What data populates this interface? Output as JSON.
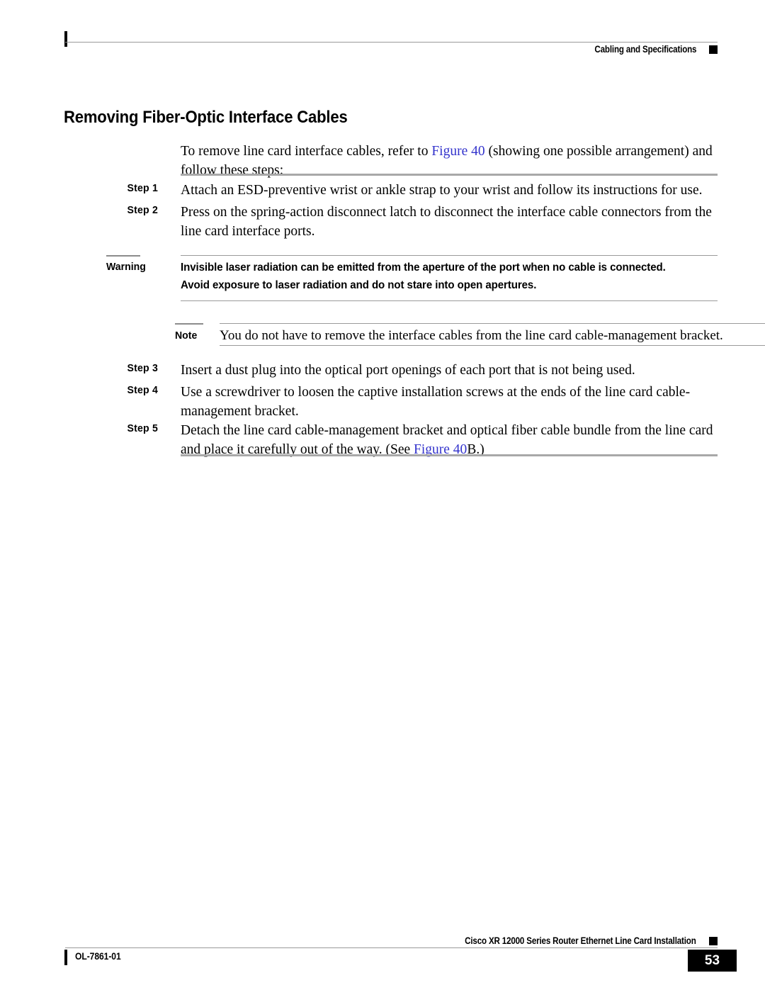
{
  "header": {
    "title": "Cabling and Specifications",
    "marker_icon": "black-square-marker"
  },
  "section": {
    "heading": "Removing Fiber-Optic Interface Cables",
    "intro_before_link": "To remove line card interface cables, refer to ",
    "intro_link": "Figure 40",
    "intro_after_link": " (showing one possible arrangement) and follow these steps:"
  },
  "steps": [
    {
      "label": "Step 1",
      "text": "Attach an ESD-preventive wrist or ankle strap to your wrist and follow its instructions for use."
    },
    {
      "label": "Step 2",
      "text": "Press on the spring-action disconnect latch to disconnect the interface cable connectors from the line card interface ports."
    },
    {
      "label": "Step 3",
      "text": "Insert a dust plug into the optical port openings of each port that is not being used."
    },
    {
      "label": "Step 4",
      "text": "Use a screwdriver to loosen the captive installation screws at the ends of the line card cable-management bracket."
    },
    {
      "label": "Step 5",
      "text_before_link": "Detach the line card cable-management bracket and optical fiber cable bundle from the line card and place it carefully out of the way. (See ",
      "link": "Figure 40",
      "text_after_link": "B.)"
    }
  ],
  "warning": {
    "label": "Warning",
    "text": "Invisible laser radiation can be emitted from the aperture of the port when no cable is connected. Avoid exposure to laser radiation and do not stare into open apertures."
  },
  "note": {
    "label": "Note",
    "text": "You do not have to remove the interface cables from the line card cable-management bracket."
  },
  "footer": {
    "doc_id": "OL-7861-01",
    "title": "Cisco XR 12000 Series Router Ethernet Line Card Installation",
    "page_number": "53",
    "marker_icon": "black-square-marker"
  },
  "colors": {
    "link": "#3333cc",
    "rule": "#a8a8a8",
    "marker": "#000000"
  }
}
